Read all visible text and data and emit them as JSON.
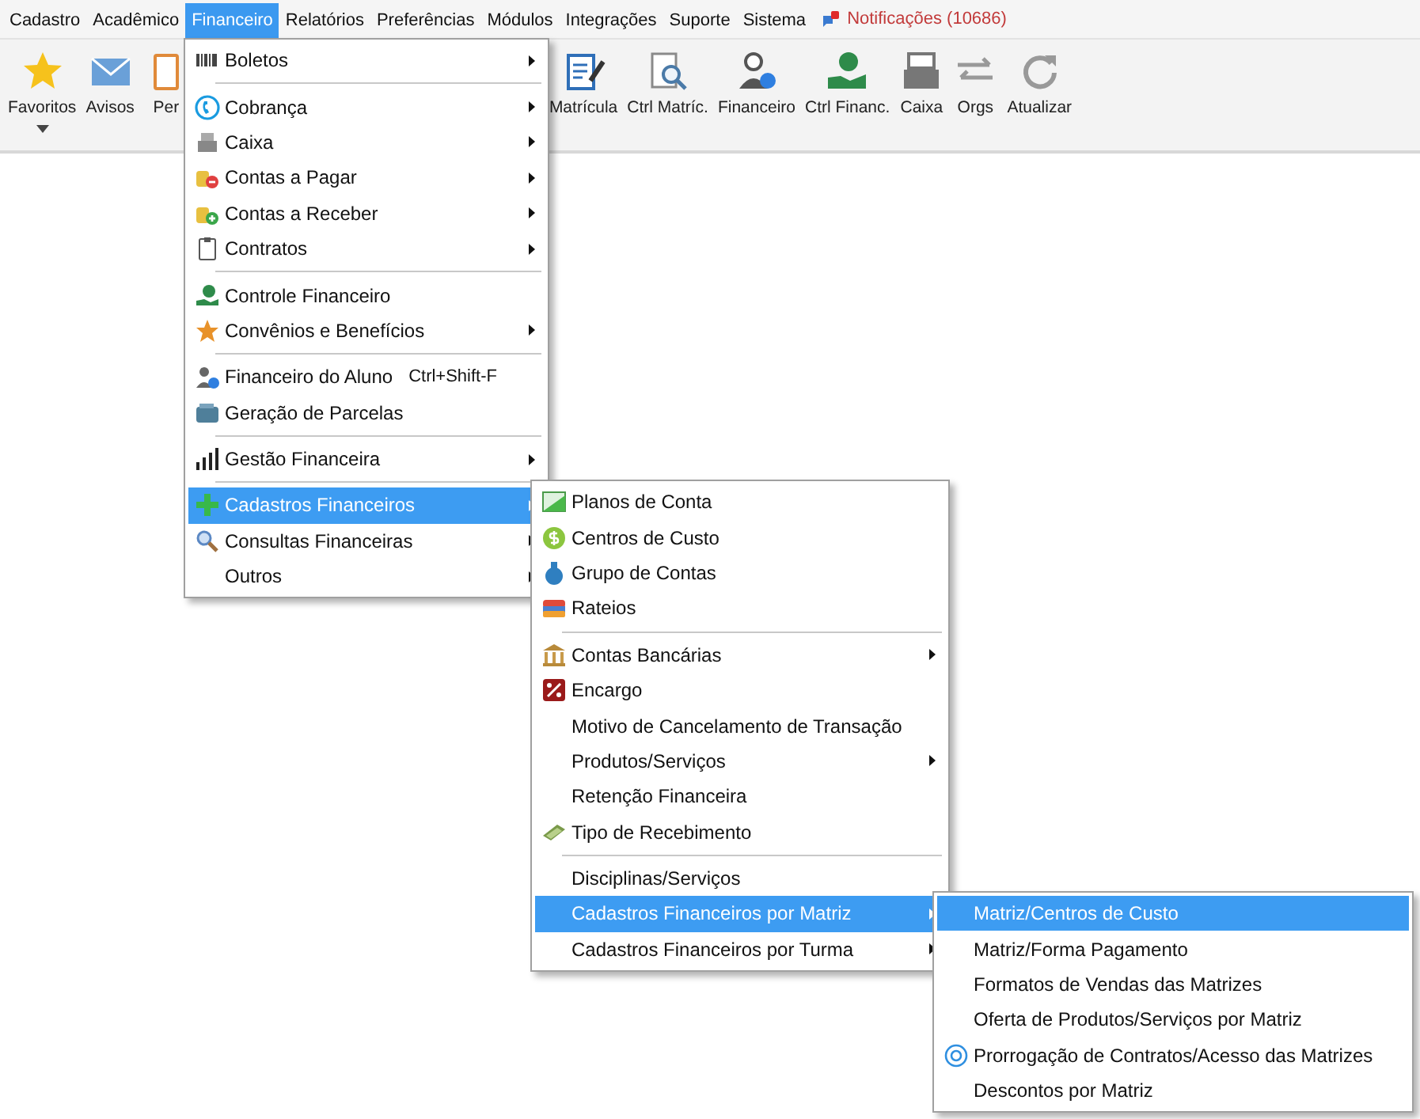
{
  "menubar": [
    {
      "label": "Cadastro",
      "selected": false
    },
    {
      "label": "Acadêmico",
      "selected": false
    },
    {
      "label": "Financeiro",
      "selected": true
    },
    {
      "label": "Relatórios",
      "selected": false
    },
    {
      "label": "Preferências",
      "selected": false
    },
    {
      "label": "Módulos",
      "selected": false
    },
    {
      "label": "Integrações",
      "selected": false
    },
    {
      "label": "Suporte",
      "selected": false
    },
    {
      "label": "Sistema",
      "selected": false
    }
  ],
  "notifications": {
    "label": "Notificações (10686)"
  },
  "toolbar": [
    {
      "label": "Favoritos",
      "dropdown": true
    },
    {
      "label": "Avisos",
      "dropdown": false
    },
    {
      "label": "Per",
      "dropdown": false
    },
    {
      "label": "Matrícula",
      "dropdown": false
    },
    {
      "label": "Ctrl Matríc.",
      "dropdown": false
    },
    {
      "label": "Financeiro",
      "dropdown": false
    },
    {
      "label": "Ctrl Financ.",
      "dropdown": false
    },
    {
      "label": "Caixa",
      "dropdown": false
    },
    {
      "label": "Orgs",
      "dropdown": false
    },
    {
      "label": "Atualizar",
      "dropdown": false
    }
  ],
  "menus": [
    {
      "items": [
        {
          "kind": "item",
          "label": "Boletos",
          "submenu": true,
          "selected": false
        },
        {
          "kind": "separator"
        },
        {
          "kind": "item",
          "label": "Cobrança",
          "submenu": true,
          "selected": false
        },
        {
          "kind": "item",
          "label": "Caixa",
          "submenu": true,
          "selected": false
        },
        {
          "kind": "item",
          "label": "Contas a Pagar",
          "submenu": true,
          "selected": false
        },
        {
          "kind": "item",
          "label": "Contas a Receber",
          "submenu": true,
          "selected": false
        },
        {
          "kind": "item",
          "label": "Contratos",
          "submenu": true,
          "selected": false
        },
        {
          "kind": "separator"
        },
        {
          "kind": "item",
          "label": "Controle Financeiro",
          "submenu": false,
          "selected": false
        },
        {
          "kind": "item",
          "label": "Convênios e Benefícios",
          "submenu": true,
          "selected": false
        },
        {
          "kind": "separator"
        },
        {
          "kind": "item",
          "label": "Financeiro do Aluno",
          "shortcut": "Ctrl+Shift-F",
          "submenu": false,
          "selected": false
        },
        {
          "kind": "item",
          "label": "Geração de Parcelas",
          "submenu": false,
          "selected": false
        },
        {
          "kind": "separator"
        },
        {
          "kind": "item",
          "label": "Gestão Financeira",
          "submenu": true,
          "selected": false
        },
        {
          "kind": "separator"
        },
        {
          "kind": "item",
          "label": "Cadastros Financeiros",
          "submenu": true,
          "selected": true
        },
        {
          "kind": "item",
          "label": "Consultas Financeiras",
          "submenu": true,
          "selected": false
        },
        {
          "kind": "item",
          "label": "Outros",
          "submenu": true,
          "selected": false
        }
      ]
    },
    {
      "items": [
        {
          "kind": "item",
          "label": "Planos de Conta",
          "submenu": false,
          "selected": false
        },
        {
          "kind": "item",
          "label": "Centros de Custo",
          "submenu": false,
          "selected": false
        },
        {
          "kind": "item",
          "label": "Grupo de Contas",
          "submenu": false,
          "selected": false
        },
        {
          "kind": "item",
          "label": "Rateios",
          "submenu": false,
          "selected": false
        },
        {
          "kind": "separator"
        },
        {
          "kind": "item",
          "label": "Contas Bancárias",
          "submenu": true,
          "selected": false
        },
        {
          "kind": "item",
          "label": "Encargo",
          "submenu": false,
          "selected": false
        },
        {
          "kind": "item",
          "label": "Motivo de Cancelamento de Transação",
          "submenu": false,
          "selected": false
        },
        {
          "kind": "item",
          "label": "Produtos/Serviços",
          "submenu": true,
          "selected": false
        },
        {
          "kind": "item",
          "label": "Retenção Financeira",
          "submenu": false,
          "selected": false
        },
        {
          "kind": "item",
          "label": "Tipo de Recebimento",
          "submenu": false,
          "selected": false
        },
        {
          "kind": "separator"
        },
        {
          "kind": "item",
          "label": "Disciplinas/Serviços",
          "submenu": false,
          "selected": false
        },
        {
          "kind": "item",
          "label": "Cadastros Financeiros por Matriz",
          "submenu": true,
          "selected": true
        },
        {
          "kind": "item",
          "label": "Cadastros Financeiros por Turma",
          "submenu": true,
          "selected": false
        }
      ]
    },
    {
      "items": [
        {
          "kind": "item",
          "label": "Matriz/Centros de Custo",
          "submenu": false,
          "selected": true
        },
        {
          "kind": "item",
          "label": "Matriz/Forma Pagamento",
          "submenu": false,
          "selected": false
        },
        {
          "kind": "item",
          "label": "Formatos de Vendas das Matrizes",
          "submenu": false,
          "selected": false
        },
        {
          "kind": "item",
          "label": "Oferta de Produtos/Serviços por Matriz",
          "submenu": false,
          "selected": false
        },
        {
          "kind": "item",
          "label": "Prorrogação de Contratos/Acesso das Matrizes",
          "submenu": false,
          "selected": false
        },
        {
          "kind": "item",
          "label": "Descontos por Matriz",
          "submenu": false,
          "selected": false
        }
      ]
    }
  ]
}
